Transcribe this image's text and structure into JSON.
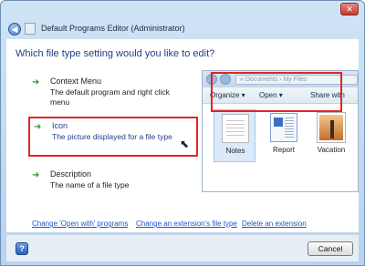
{
  "window": {
    "title": "Default Programs Editor (Administrator)",
    "close_symbol": "✕",
    "back_symbol": "◀"
  },
  "main": {
    "heading": "Which file type setting would you like to edit?",
    "options": [
      {
        "title": "Context Menu",
        "description": "The default program and right click menu",
        "icon": "green-arrow-icon"
      },
      {
        "title": "Icon",
        "description": "The picture displayed for a file type",
        "icon": "green-arrow-icon",
        "selected": true
      },
      {
        "title": "Description",
        "description": "The name of a file type",
        "icon": "green-arrow-icon"
      }
    ]
  },
  "preview": {
    "address_text": "« Documents › My Files",
    "toolbar": [
      "Organize ▾",
      "Open ▾",
      "Share with"
    ],
    "files": [
      {
        "label": "Notes",
        "selected": true
      },
      {
        "label": "Report"
      },
      {
        "label": "Vacation"
      }
    ]
  },
  "links": [
    "Change 'Open with' programs",
    "Change an extension's file type",
    "Delete an extension"
  ],
  "footer": {
    "help_symbol": "?",
    "cancel_label": "Cancel"
  },
  "colors": {
    "accent_red": "#e02626",
    "link_blue": "#1f56c8",
    "heading_blue": "#1e3f86",
    "arrow_green": "#2e9b2e"
  }
}
